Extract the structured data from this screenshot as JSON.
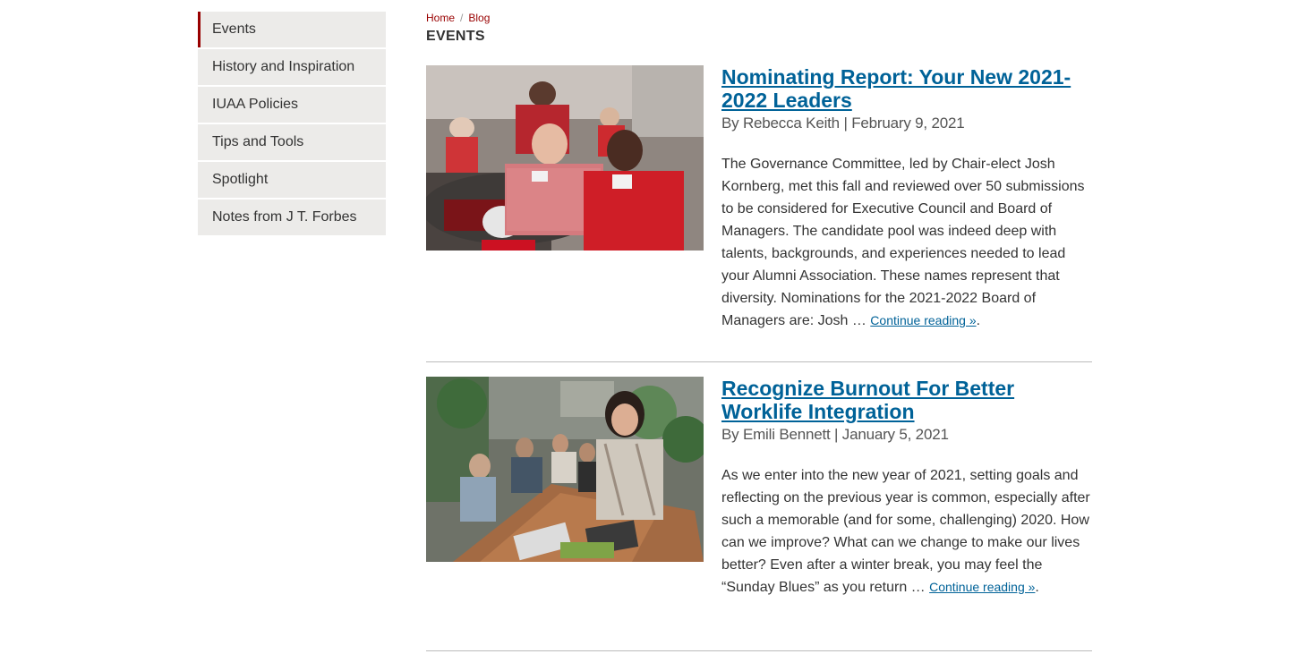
{
  "sidebar": {
    "items": [
      {
        "label": "Events",
        "active": true
      },
      {
        "label": "History and Inspiration"
      },
      {
        "label": "IUAA Policies"
      },
      {
        "label": "Tips and Tools"
      },
      {
        "label": "Spotlight"
      },
      {
        "label": "Notes from J T. Forbes"
      }
    ]
  },
  "breadcrumb": {
    "home": "Home",
    "separator": "/",
    "blog": "Blog"
  },
  "page_title": "EVENTS",
  "posts": [
    {
      "title": "Nominating Report: Your New 2021-2022 Leaders",
      "byline": "By Rebecca Keith | February 9, 2021",
      "excerpt": "The Governance Committee, led by Chair-elect Josh Kornberg, met this fall and reviewed over 50 submissions to be considered for Executive Council and Board of Managers. The candidate pool was indeed deep with talents, backgrounds, and experiences needed to lead your Alumni Association. These names represent that diversity. Nominations for the 2021-2022 Board of Managers are: Josh … ",
      "continue": "Continue reading »",
      "trail": "."
    },
    {
      "title": "Recognize Burnout For Better Worklife Integration",
      "byline": "By Emili Bennett | January 5, 2021",
      "excerpt": "As we enter into the new year of 2021, setting goals and reflecting on the previous year is common, especially after such a memorable (and for some, challenging) 2020. How can we improve? What can we change to make our lives better? Even after a winter break, you may feel the “Sunday Blues” as you return … ",
      "continue": "Continue reading »",
      "trail": "."
    }
  ],
  "colors": {
    "accent": "#990000",
    "link": "#006298",
    "sidebar_bg": "#ecebe9"
  }
}
